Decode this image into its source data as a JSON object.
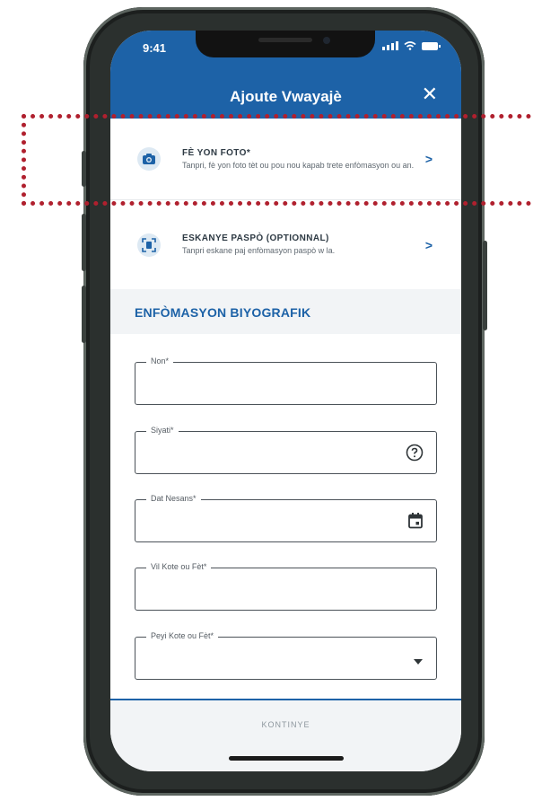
{
  "status_bar": {
    "time": "9:41"
  },
  "header": {
    "title": "Ajoute Vwayajè",
    "close_glyph": "✕"
  },
  "options": [
    {
      "title": "FÈ YON FOTO*",
      "subtitle": "Tanpri, fè yon foto tèt ou pou nou kapab trete enfòmasyon ou an.",
      "icon": "camera-icon"
    },
    {
      "title": "ESKANYE PASPÒ (OPTIONNAL)",
      "subtitle": "Tanpri eskane paj enfòmasyon paspò w la.",
      "icon": "scan-icon"
    }
  ],
  "section": {
    "title": "ENFÒMASYON BIYOGRAFIK"
  },
  "fields": [
    {
      "label": "Non*"
    },
    {
      "label": "Siyati*",
      "icon": "help-icon"
    },
    {
      "label": "Dat Nesans*",
      "icon": "calendar-icon"
    },
    {
      "label": "Vil Kote ou Fèt*"
    },
    {
      "label": "Peyi Kote ou Fèt*",
      "icon": "dropdown-arrow-icon"
    }
  ],
  "footer": {
    "continue_label": "KONTINYE"
  },
  "colors": {
    "primary": "#1d62a7",
    "highlight": "#b0202e",
    "frame": "#2b302e"
  }
}
